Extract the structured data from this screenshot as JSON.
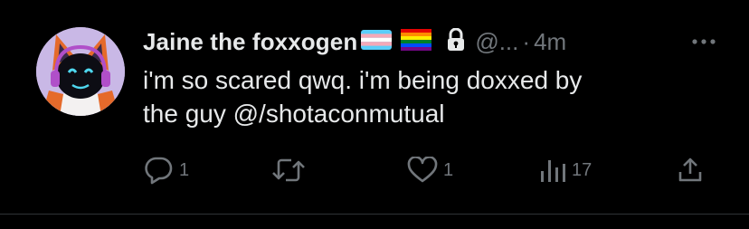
{
  "tweet": {
    "display_name": "Jaine the foxxogen",
    "handle": "@...",
    "separator": "·",
    "time": "4m",
    "text": "i'm so scared qwq. i'm being doxxed by\nthe guy @/shotaconmutual",
    "protected": true,
    "name_emoji": [
      "transgender-flag",
      "rainbow-flag"
    ]
  },
  "actions": {
    "reply_count": "1",
    "retweet_count": "",
    "like_count": "1",
    "views_count": "17"
  },
  "colors": {
    "background": "#000000",
    "text": "#e7e9ea",
    "muted": "#71767b",
    "divider": "#2f3336"
  },
  "icons": {
    "reply": "reply-icon",
    "retweet": "retweet-icon",
    "like": "heart-icon",
    "views": "views-icon",
    "share": "share-icon",
    "more": "more-icon",
    "lock": "lock-icon"
  }
}
